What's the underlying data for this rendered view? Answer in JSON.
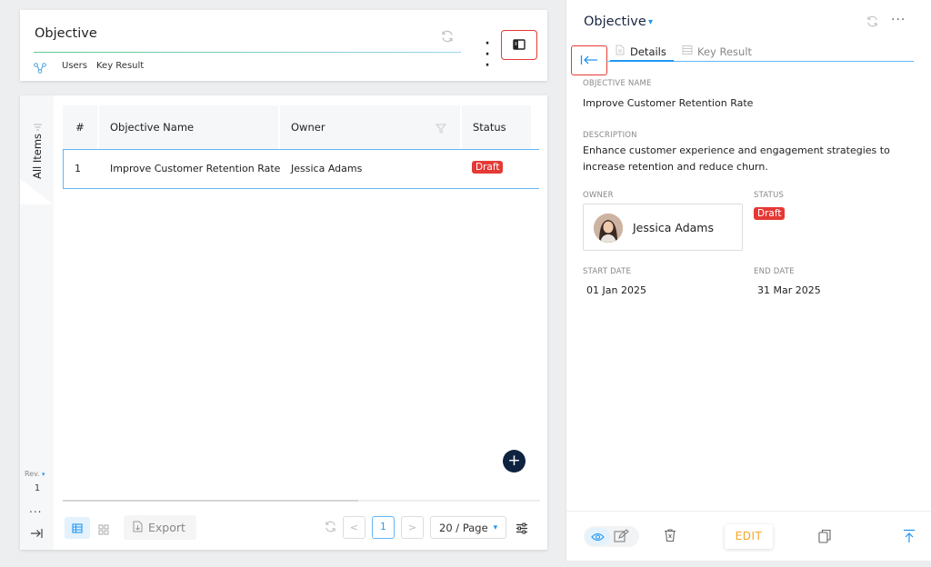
{
  "header": {
    "title": "Objective",
    "links": {
      "users": "Users",
      "key_result": "Key Result"
    }
  },
  "sidebar": {
    "tab_label": "All Items",
    "rev_label": "Rev.",
    "rev_value": "1",
    "more": "..."
  },
  "table": {
    "columns": [
      "#",
      "Objective Name",
      "Owner",
      "Status"
    ],
    "rows": [
      {
        "num": "1",
        "name": "Improve Customer Retention Rate",
        "owner": "Jessica Adams",
        "status": "Draft"
      }
    ]
  },
  "footer": {
    "export_label": "Export",
    "prev": "<",
    "page": "1",
    "next": ">",
    "page_size": "20 / Page"
  },
  "fab_label": "+",
  "detail": {
    "title": "Objective",
    "more": "···",
    "tabs": {
      "details": "Details",
      "key_result": "Key Result"
    },
    "objective_name_label": "OBJECTIVE NAME",
    "objective_name": "Improve Customer Retention Rate",
    "description_label": "DESCRIPTION",
    "description": "Enhance customer experience and engagement strategies to increase retention and reduce churn.",
    "owner_label": "OWNER",
    "owner": "Jessica Adams",
    "status_label": "STATUS",
    "status": "Draft",
    "start_date_label": "START DATE",
    "start_date": "01 Jan 2025",
    "end_date_label": "END DATE",
    "end_date": "31 Mar 2025",
    "edit_label": "EDIT"
  },
  "colors": {
    "accent": "#2196f3",
    "danger": "#e53935",
    "fab": "#0f2340",
    "edit": "#f5a623"
  }
}
